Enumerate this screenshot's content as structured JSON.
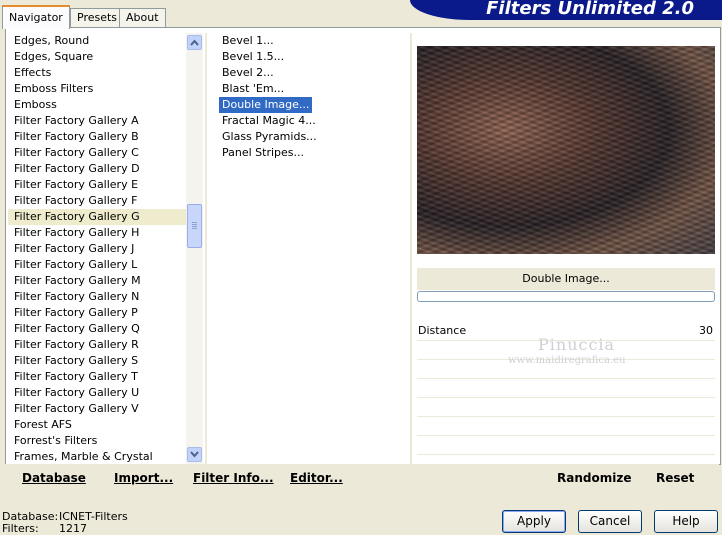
{
  "tabs": [
    {
      "label": "Navigator",
      "active": true
    },
    {
      "label": "Presets",
      "active": false
    },
    {
      "label": "About",
      "active": false
    }
  ],
  "banner_title": "Filters Unlimited 2.0",
  "categories": [
    "Edges, Round",
    "Edges, Square",
    "Effects",
    "Emboss Filters",
    "Emboss",
    "Filter Factory Gallery A",
    "Filter Factory Gallery B",
    "Filter Factory Gallery C",
    "Filter Factory Gallery D",
    "Filter Factory Gallery E",
    "Filter Factory Gallery F",
    "Filter Factory Gallery G",
    "Filter Factory Gallery H",
    "Filter Factory Gallery J",
    "Filter Factory Gallery L",
    "Filter Factory Gallery M",
    "Filter Factory Gallery N",
    "Filter Factory Gallery P",
    "Filter Factory Gallery Q",
    "Filter Factory Gallery R",
    "Filter Factory Gallery S",
    "Filter Factory Gallery T",
    "Filter Factory Gallery U",
    "Filter Factory Gallery V",
    "Forest AFS",
    "Forrest's Filters",
    "Frames, Marble & Crystal"
  ],
  "selected_category": "Filter Factory Gallery G",
  "filters": [
    "Bevel 1...",
    "Bevel 1.5...",
    "Bevel 2...",
    "Blast 'Em...",
    "Double Image...",
    "Fractal Magic 4...",
    "Glass Pyramids...",
    "Panel Stripes..."
  ],
  "selected_filter": "Double Image...",
  "preview_filter_name": "Double Image...",
  "parameters": [
    {
      "label": "Distance",
      "value": "30"
    }
  ],
  "watermark": {
    "name": "Pinuccia",
    "site": "www.maidiregrafica.eu"
  },
  "bottom_links": {
    "database": "Database",
    "import": "Import...",
    "filter_info": "Filter Info...",
    "editor": "Editor...",
    "randomize": "Randomize",
    "reset": "Reset"
  },
  "status": {
    "database_label": "Database:",
    "database_value": "ICNET-Filters",
    "filters_label": "Filters:",
    "filters_value": "1217"
  },
  "dialog_buttons": {
    "apply": "Apply",
    "cancel": "Cancel",
    "help": "Help"
  },
  "colors": {
    "banner": "#0a1a8a",
    "selection": "#316ac5",
    "background": "#ece9d8"
  }
}
